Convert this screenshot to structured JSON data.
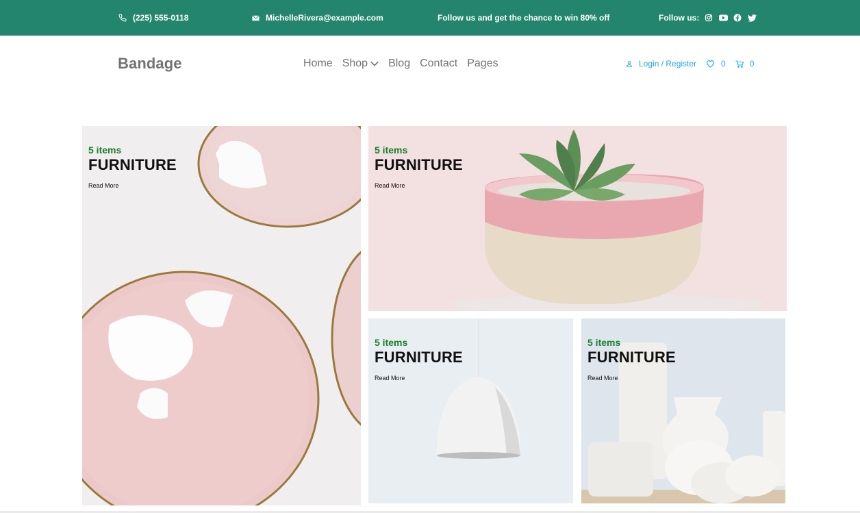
{
  "topbar": {
    "phone": "(225) 555-0118",
    "email": "MichelleRivera@example.com",
    "promo": "Follow us and get the chance to win 80% off",
    "follow_label": "Follow us:",
    "icons": [
      "phone-icon",
      "mail-icon",
      "instagram-icon",
      "youtube-icon",
      "facebook-icon",
      "twitter-icon"
    ]
  },
  "nav": {
    "brand": "Bandage",
    "menu": [
      "Home",
      "Shop",
      "Blog",
      "Contact",
      "Pages"
    ],
    "login": "Login / Register",
    "wishlist_count": "0",
    "cart_count": "0"
  },
  "cards": [
    {
      "items": "5 items",
      "title": "FURNITURE",
      "link": "Read More"
    },
    {
      "items": "5 items",
      "title": "FURNITURE",
      "link": "Read More"
    },
    {
      "items": "5 items",
      "title": "FURNITURE",
      "link": "Read More"
    },
    {
      "items": "5 items",
      "title": "FURNITURE",
      "link": "Read More"
    }
  ],
  "colors": {
    "topbar": "#23856d",
    "accent": "#23a6f0",
    "items_green": "#19802a",
    "nav_text": "#737373"
  }
}
